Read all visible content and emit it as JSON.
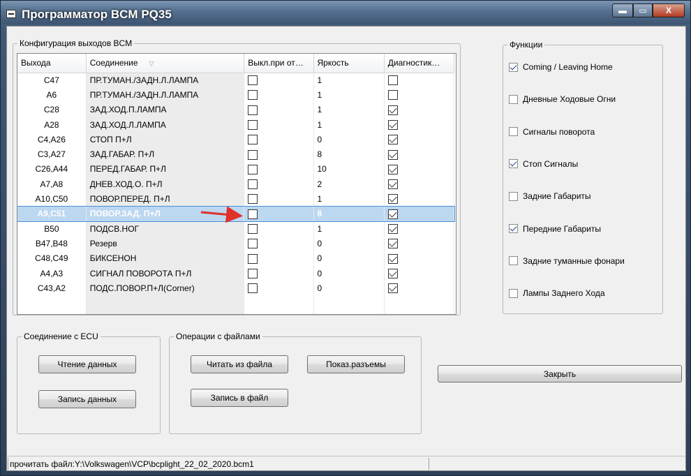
{
  "window": {
    "title": "Программатор BCM PQ35",
    "controls": {
      "minimize": "▬",
      "restore": "▭",
      "close": "X"
    }
  },
  "config_group": {
    "legend": "Конфигурация выходов BCM",
    "columns": [
      "Выхода",
      "Соединение",
      "Выкл.при от…",
      "Яркость",
      "Диагностик…"
    ],
    "rows": [
      {
        "out": "C47",
        "conn": "ПР.ТУМАН./ЗАДН.Л.ЛАМПА",
        "off": false,
        "bright": "1",
        "diag": false
      },
      {
        "out": "A6",
        "conn": "ПР.ТУМАН./ЗАДН.Л.ЛАМПА",
        "off": false,
        "bright": "1",
        "diag": false
      },
      {
        "out": "C28",
        "conn": "ЗАД.ХОД.П.ЛАМПА",
        "off": false,
        "bright": "1",
        "diag": true
      },
      {
        "out": "A28",
        "conn": "ЗАД.ХОД.Л.ЛАМПА",
        "off": false,
        "bright": "1",
        "diag": true
      },
      {
        "out": "C4,A26",
        "conn": "СТОП П+Л",
        "off": false,
        "bright": "0",
        "diag": true
      },
      {
        "out": "C3,A27",
        "conn": "ЗАД.ГАБАР. П+Л",
        "off": false,
        "bright": "8",
        "diag": true
      },
      {
        "out": "C26,A44",
        "conn": "ПЕРЕД.ГАБАР. П+Л",
        "off": false,
        "bright": "10",
        "diag": true
      },
      {
        "out": "A7,A8",
        "conn": "ДНЕВ.ХОД.О. П+Л",
        "off": false,
        "bright": "2",
        "diag": true
      },
      {
        "out": "A10,C50",
        "conn": "ПОВОР.ПЕРЕД. П+Л",
        "off": false,
        "bright": "1",
        "diag": true
      },
      {
        "out": "A9,C51",
        "conn": "ПОВОР.ЗАД. П+Л",
        "off": false,
        "bright": "8",
        "diag": true,
        "selected": true
      },
      {
        "out": "B50",
        "conn": "ПОДСВ.НОГ",
        "off": false,
        "bright": "1",
        "diag": true
      },
      {
        "out": "B47,B48",
        "conn": "Резерв",
        "off": false,
        "bright": "0",
        "diag": true
      },
      {
        "out": "C48,C49",
        "conn": "БИКСЕНОН",
        "off": false,
        "bright": "0",
        "diag": true
      },
      {
        "out": "A4,A3",
        "conn": "СИГНАЛ ПОВОРОТА П+Л",
        "off": false,
        "bright": "0",
        "diag": true
      },
      {
        "out": "C43,A2",
        "conn": "ПОДС.ПОВОР.П+Л(Corner)",
        "off": false,
        "bright": "0",
        "diag": true
      }
    ]
  },
  "functions_group": {
    "legend": "Функции",
    "items": [
      {
        "label": "Coming / Leaving Home",
        "checked": true
      },
      {
        "label": "Дневные Ходовые Огни",
        "checked": false
      },
      {
        "label": "Сигналы поворота",
        "checked": false
      },
      {
        "label": "Стоп Сигналы",
        "checked": true
      },
      {
        "label": "Задние Габариты",
        "checked": false
      },
      {
        "label": "Передние Габариты",
        "checked": true
      },
      {
        "label": "Задние туманные фонари",
        "checked": false
      },
      {
        "label": "Лампы Заднего Хода",
        "checked": false
      }
    ]
  },
  "ecu_group": {
    "legend": "Соединение с ECU",
    "read_label": "Чтение данных",
    "write_label": "Запись данных"
  },
  "files_group": {
    "legend": "Операции с файлами",
    "read_file_label": "Читать из файла",
    "show_connectors_label": "Показ.разъемы",
    "write_file_label": "Запись в файл"
  },
  "close_label": "Закрыть",
  "status": {
    "text": "прочитать файл:Y:\\Volkswagen\\VCP\\bcplight_22_02_2020.bcm1"
  },
  "colors": {
    "selection": "#bcd7f0",
    "arrow": "#e0302a"
  }
}
